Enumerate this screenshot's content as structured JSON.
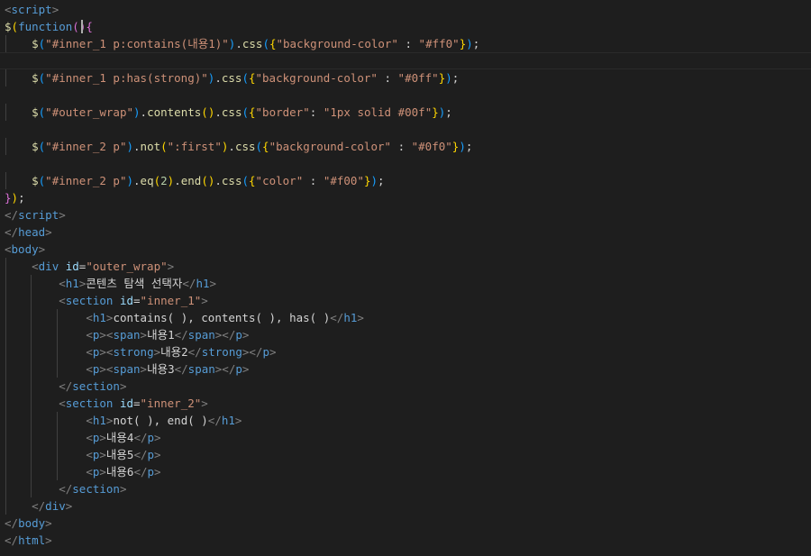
{
  "editor": {
    "lines": [
      [
        [
          "tg",
          "<"
        ],
        [
          "tn",
          "script"
        ],
        [
          "tg",
          ">"
        ]
      ],
      [
        [
          "fn",
          "$"
        ],
        [
          "br",
          "("
        ],
        [
          "kw",
          "function"
        ],
        [
          "br2",
          "("
        ],
        [
          "br2",
          ")"
        ],
        [
          "br2",
          "{"
        ]
      ],
      [
        [
          "tx",
          "    "
        ],
        [
          "fn",
          "$"
        ],
        [
          "br3",
          "("
        ],
        [
          "st",
          "\"#inner_1 p:contains(내용1)\""
        ],
        [
          "br3",
          ")"
        ],
        [
          "pu",
          "."
        ],
        [
          "fn",
          "css"
        ],
        [
          "br3",
          "("
        ],
        [
          "br",
          "{"
        ],
        [
          "st",
          "\"background-color\""
        ],
        [
          "pu",
          " : "
        ],
        [
          "st",
          "\"#ff0\""
        ],
        [
          "br",
          "}"
        ],
        [
          "br3",
          ")"
        ],
        [
          "pu",
          ";"
        ]
      ],
      [],
      [
        [
          "tx",
          "    "
        ],
        [
          "fn",
          "$"
        ],
        [
          "br3",
          "("
        ],
        [
          "st",
          "\"#inner_1 p:has(strong)\""
        ],
        [
          "br3",
          ")"
        ],
        [
          "pu",
          "."
        ],
        [
          "fn",
          "css"
        ],
        [
          "br3",
          "("
        ],
        [
          "br",
          "{"
        ],
        [
          "st",
          "\"background-color\""
        ],
        [
          "pu",
          " : "
        ],
        [
          "st",
          "\"#0ff\""
        ],
        [
          "br",
          "}"
        ],
        [
          "br3",
          ")"
        ],
        [
          "pu",
          ";"
        ]
      ],
      [],
      [
        [
          "tx",
          "    "
        ],
        [
          "fn",
          "$"
        ],
        [
          "br3",
          "("
        ],
        [
          "st",
          "\"#outer_wrap\""
        ],
        [
          "br3",
          ")"
        ],
        [
          "pu",
          "."
        ],
        [
          "fn",
          "contents"
        ],
        [
          "br",
          "("
        ],
        [
          "br",
          ")"
        ],
        [
          "pu",
          "."
        ],
        [
          "fn",
          "css"
        ],
        [
          "br3",
          "("
        ],
        [
          "br",
          "{"
        ],
        [
          "st",
          "\"border\""
        ],
        [
          "pu",
          ": "
        ],
        [
          "st",
          "\"1px solid #00f\""
        ],
        [
          "br",
          "}"
        ],
        [
          "br3",
          ")"
        ],
        [
          "pu",
          ";"
        ]
      ],
      [],
      [
        [
          "tx",
          "    "
        ],
        [
          "fn",
          "$"
        ],
        [
          "br3",
          "("
        ],
        [
          "st",
          "\"#inner_2 p\""
        ],
        [
          "br3",
          ")"
        ],
        [
          "pu",
          "."
        ],
        [
          "fn",
          "not"
        ],
        [
          "br",
          "("
        ],
        [
          "st",
          "\":first\""
        ],
        [
          "br",
          ")"
        ],
        [
          "pu",
          "."
        ],
        [
          "fn",
          "css"
        ],
        [
          "br3",
          "("
        ],
        [
          "br",
          "{"
        ],
        [
          "st",
          "\"background-color\""
        ],
        [
          "pu",
          " : "
        ],
        [
          "st",
          "\"#0f0\""
        ],
        [
          "br",
          "}"
        ],
        [
          "br3",
          ")"
        ],
        [
          "pu",
          ";"
        ]
      ],
      [],
      [
        [
          "tx",
          "    "
        ],
        [
          "fn",
          "$"
        ],
        [
          "br3",
          "("
        ],
        [
          "st",
          "\"#inner_2 p\""
        ],
        [
          "br3",
          ")"
        ],
        [
          "pu",
          "."
        ],
        [
          "fn",
          "eq"
        ],
        [
          "br",
          "("
        ],
        [
          "nu",
          "2"
        ],
        [
          "br",
          ")"
        ],
        [
          "pu",
          "."
        ],
        [
          "fn",
          "end"
        ],
        [
          "br",
          "("
        ],
        [
          "br",
          ")"
        ],
        [
          "pu",
          "."
        ],
        [
          "fn",
          "css"
        ],
        [
          "br3",
          "("
        ],
        [
          "br",
          "{"
        ],
        [
          "st",
          "\"color\""
        ],
        [
          "pu",
          " : "
        ],
        [
          "st",
          "\"#f00\""
        ],
        [
          "br",
          "}"
        ],
        [
          "br3",
          ")"
        ],
        [
          "pu",
          ";"
        ]
      ],
      [
        [
          "br2",
          "}"
        ],
        [
          "br",
          ")"
        ],
        [
          "pu",
          ";"
        ]
      ],
      [
        [
          "tg",
          "</"
        ],
        [
          "tn",
          "script"
        ],
        [
          "tg",
          ">"
        ]
      ],
      [
        [
          "tg",
          "</"
        ],
        [
          "tn",
          "head"
        ],
        [
          "tg",
          ">"
        ]
      ],
      [
        [
          "tg",
          "<"
        ],
        [
          "tn",
          "body"
        ],
        [
          "tg",
          ">"
        ]
      ],
      [
        [
          "tx",
          "    "
        ],
        [
          "tg",
          "<"
        ],
        [
          "tn",
          "div"
        ],
        [
          "at",
          " id"
        ],
        [
          "pu",
          "="
        ],
        [
          "av",
          "\"outer_wrap\""
        ],
        [
          "tg",
          ">"
        ]
      ],
      [
        [
          "tx",
          "        "
        ],
        [
          "tg",
          "<"
        ],
        [
          "tn",
          "h1"
        ],
        [
          "tg",
          ">"
        ],
        [
          "tx",
          "콘텐츠 탐색 선택자"
        ],
        [
          "tg",
          "</"
        ],
        [
          "tn",
          "h1"
        ],
        [
          "tg",
          ">"
        ]
      ],
      [
        [
          "tx",
          "        "
        ],
        [
          "tg",
          "<"
        ],
        [
          "tn",
          "section"
        ],
        [
          "at",
          " id"
        ],
        [
          "pu",
          "="
        ],
        [
          "av",
          "\"inner_1\""
        ],
        [
          "tg",
          ">"
        ]
      ],
      [
        [
          "tx",
          "            "
        ],
        [
          "tg",
          "<"
        ],
        [
          "tn",
          "h1"
        ],
        [
          "tg",
          ">"
        ],
        [
          "tx",
          "contains( ), contents( ), has( )"
        ],
        [
          "tg",
          "</"
        ],
        [
          "tn",
          "h1"
        ],
        [
          "tg",
          ">"
        ]
      ],
      [
        [
          "tx",
          "            "
        ],
        [
          "tg",
          "<"
        ],
        [
          "tn",
          "p"
        ],
        [
          "tg",
          "><"
        ],
        [
          "tn",
          "span"
        ],
        [
          "tg",
          ">"
        ],
        [
          "tx",
          "내용1"
        ],
        [
          "tg",
          "</"
        ],
        [
          "tn",
          "span"
        ],
        [
          "tg",
          "></"
        ],
        [
          "tn",
          "p"
        ],
        [
          "tg",
          ">"
        ]
      ],
      [
        [
          "tx",
          "            "
        ],
        [
          "tg",
          "<"
        ],
        [
          "tn",
          "p"
        ],
        [
          "tg",
          "><"
        ],
        [
          "tn",
          "strong"
        ],
        [
          "tg",
          ">"
        ],
        [
          "tx",
          "내용2"
        ],
        [
          "tg",
          "</"
        ],
        [
          "tn",
          "strong"
        ],
        [
          "tg",
          "></"
        ],
        [
          "tn",
          "p"
        ],
        [
          "tg",
          ">"
        ]
      ],
      [
        [
          "tx",
          "            "
        ],
        [
          "tg",
          "<"
        ],
        [
          "tn",
          "p"
        ],
        [
          "tg",
          "><"
        ],
        [
          "tn",
          "span"
        ],
        [
          "tg",
          ">"
        ],
        [
          "tx",
          "내용3"
        ],
        [
          "tg",
          "</"
        ],
        [
          "tn",
          "span"
        ],
        [
          "tg",
          "></"
        ],
        [
          "tn",
          "p"
        ],
        [
          "tg",
          ">"
        ]
      ],
      [
        [
          "tx",
          "        "
        ],
        [
          "tg",
          "</"
        ],
        [
          "tn",
          "section"
        ],
        [
          "tg",
          ">"
        ]
      ],
      [
        [
          "tx",
          "        "
        ],
        [
          "tg",
          "<"
        ],
        [
          "tn",
          "section"
        ],
        [
          "at",
          " id"
        ],
        [
          "pu",
          "="
        ],
        [
          "av",
          "\"inner_2\""
        ],
        [
          "tg",
          ">"
        ]
      ],
      [
        [
          "tx",
          "            "
        ],
        [
          "tg",
          "<"
        ],
        [
          "tn",
          "h1"
        ],
        [
          "tg",
          ">"
        ],
        [
          "tx",
          "not( ), end( )"
        ],
        [
          "tg",
          "</"
        ],
        [
          "tn",
          "h1"
        ],
        [
          "tg",
          ">"
        ]
      ],
      [
        [
          "tx",
          "            "
        ],
        [
          "tg",
          "<"
        ],
        [
          "tn",
          "p"
        ],
        [
          "tg",
          ">"
        ],
        [
          "tx",
          "내용4"
        ],
        [
          "tg",
          "</"
        ],
        [
          "tn",
          "p"
        ],
        [
          "tg",
          ">"
        ]
      ],
      [
        [
          "tx",
          "            "
        ],
        [
          "tg",
          "<"
        ],
        [
          "tn",
          "p"
        ],
        [
          "tg",
          ">"
        ],
        [
          "tx",
          "내용5"
        ],
        [
          "tg",
          "</"
        ],
        [
          "tn",
          "p"
        ],
        [
          "tg",
          ">"
        ]
      ],
      [
        [
          "tx",
          "            "
        ],
        [
          "tg",
          "<"
        ],
        [
          "tn",
          "p"
        ],
        [
          "tg",
          ">"
        ],
        [
          "tx",
          "내용6"
        ],
        [
          "tg",
          "</"
        ],
        [
          "tn",
          "p"
        ],
        [
          "tg",
          ">"
        ]
      ],
      [
        [
          "tx",
          "        "
        ],
        [
          "tg",
          "</"
        ],
        [
          "tn",
          "section"
        ],
        [
          "tg",
          ">"
        ]
      ],
      [
        [
          "tx",
          "    "
        ],
        [
          "tg",
          "</"
        ],
        [
          "tn",
          "div"
        ],
        [
          "tg",
          ">"
        ]
      ],
      [
        [
          "tg",
          "</"
        ],
        [
          "tn",
          "body"
        ],
        [
          "tg",
          ">"
        ]
      ],
      [
        [
          "tg",
          "</"
        ],
        [
          "tn",
          "html"
        ],
        [
          "tg",
          ">"
        ]
      ]
    ],
    "current_line_index": 3,
    "colors": {
      "background": "#1e1e1e",
      "tag_bracket": "#808080",
      "tag_name": "#569cd6",
      "attribute": "#9cdcfe",
      "string": "#ce9178",
      "function": "#dcdcaa",
      "keyword": "#569cd6",
      "text": "#d4d4d4"
    }
  }
}
